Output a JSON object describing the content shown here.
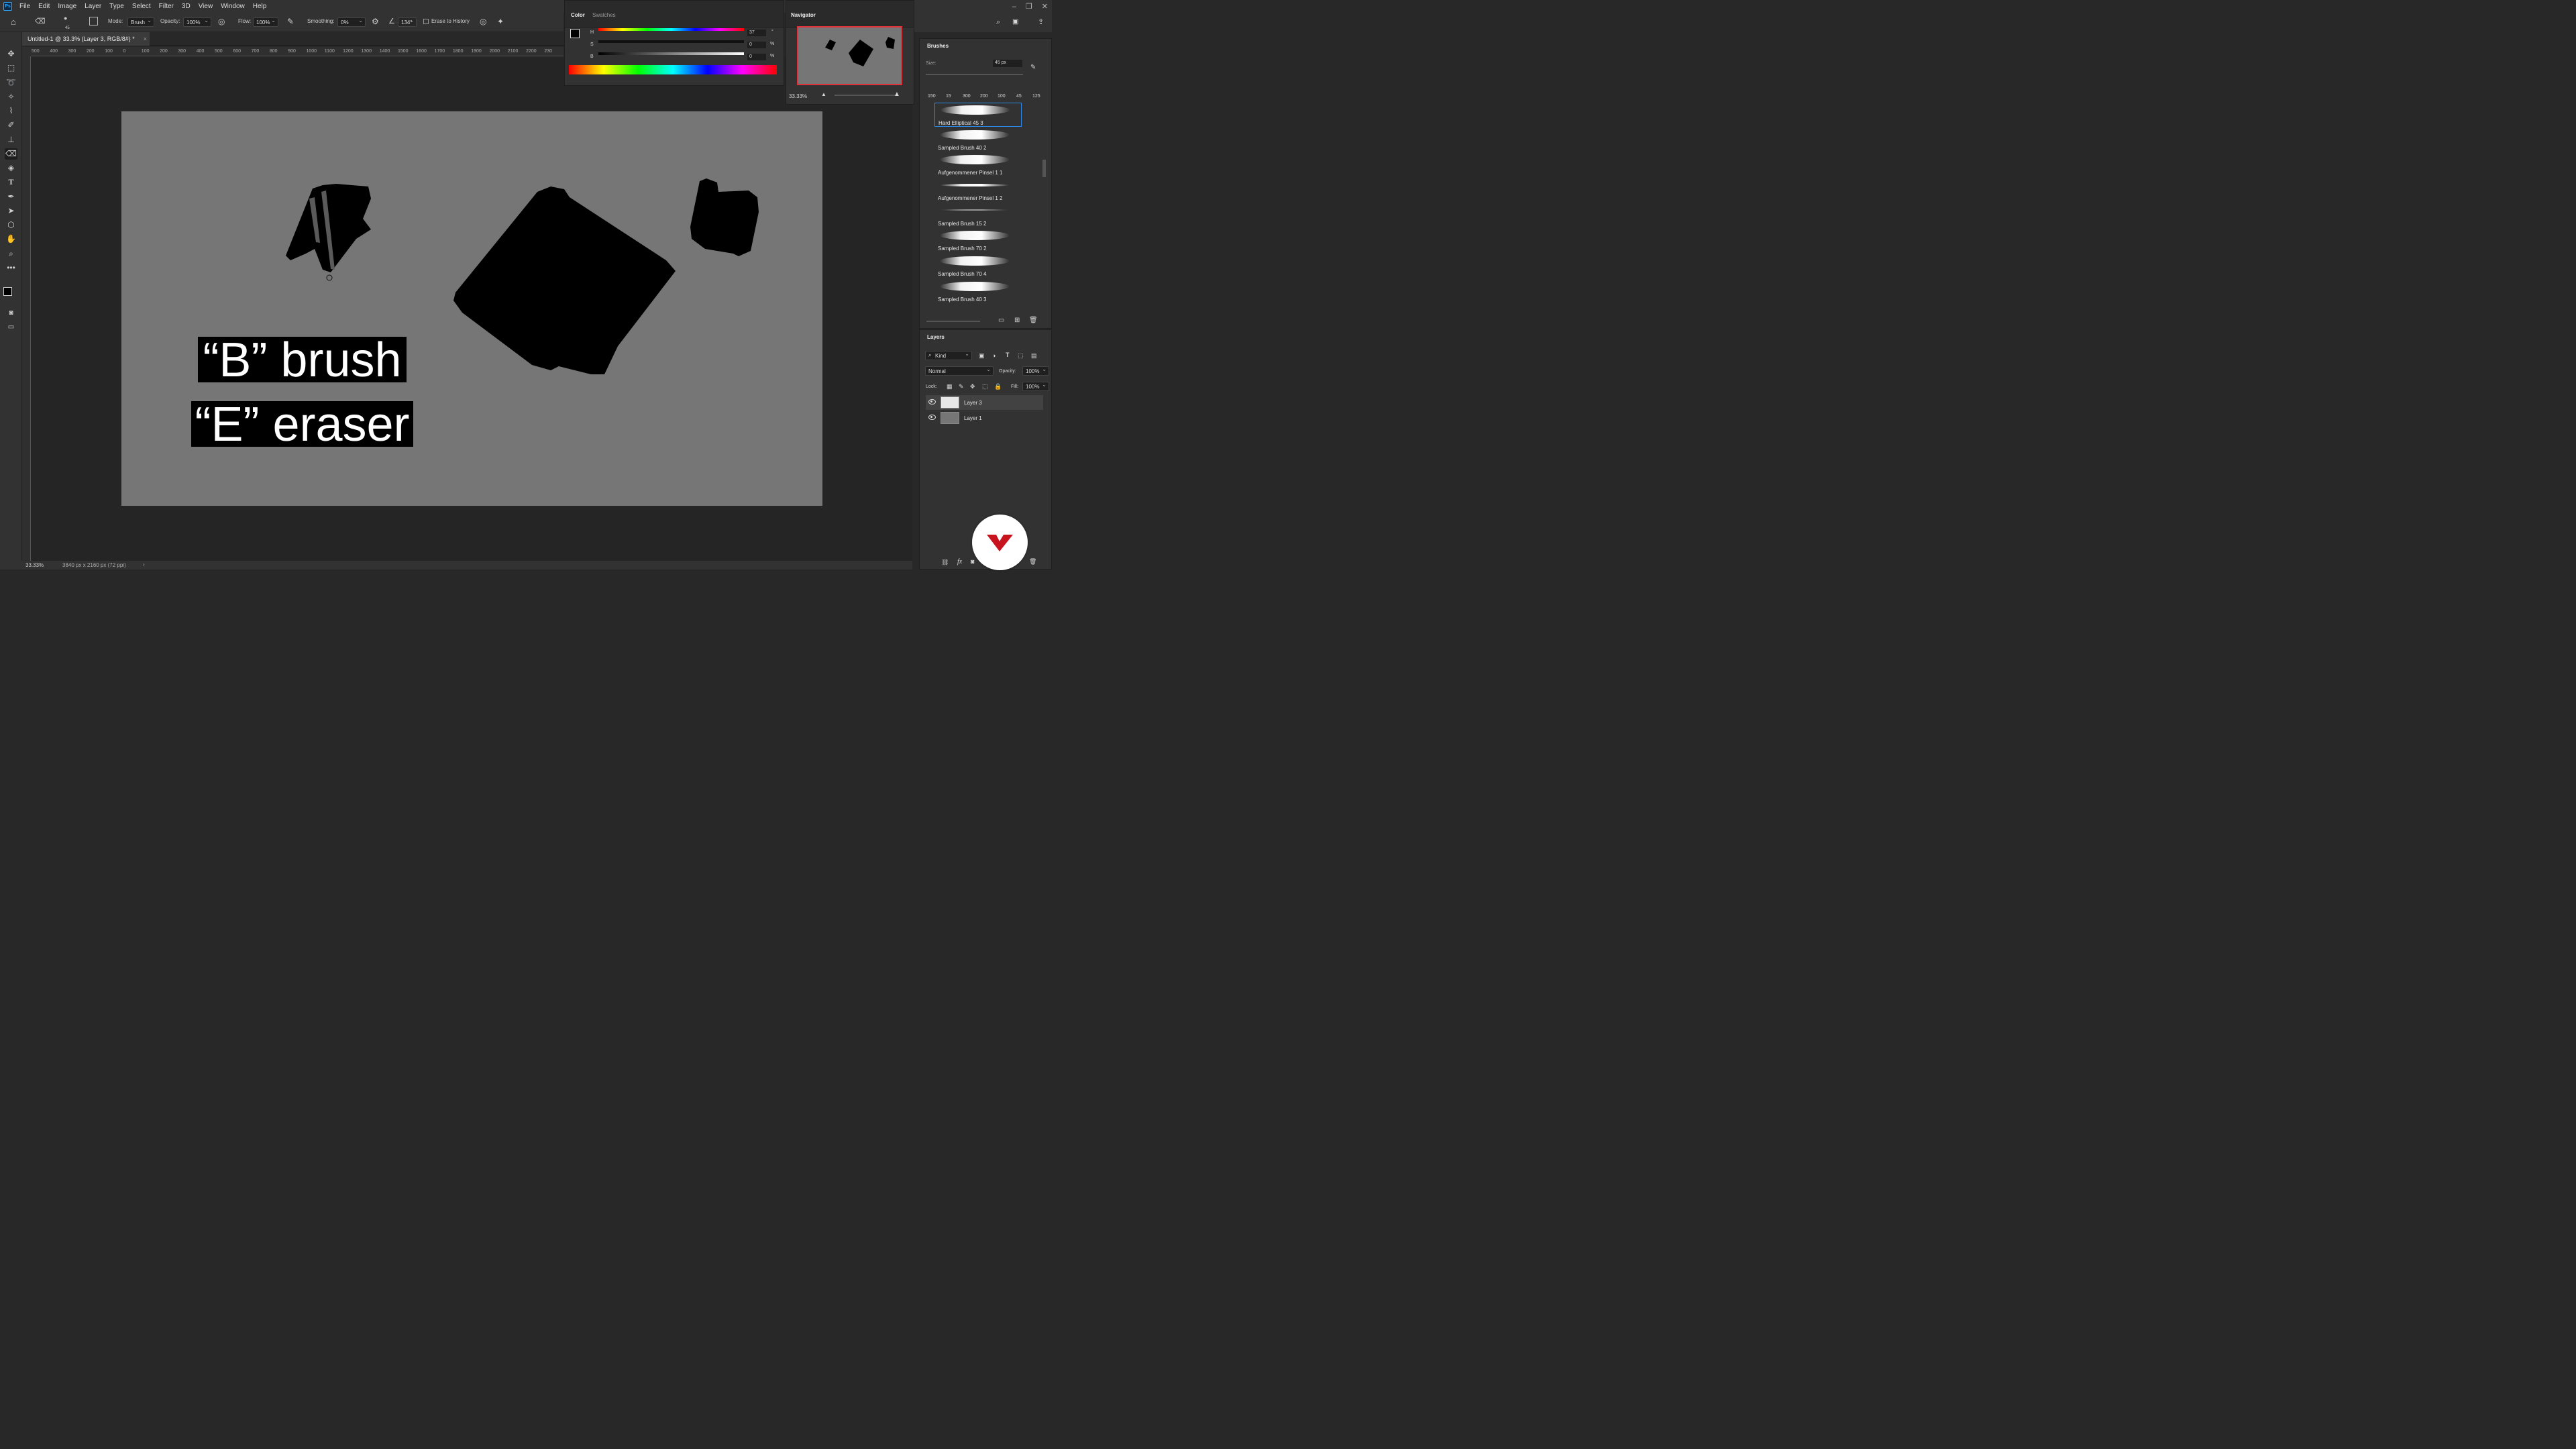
{
  "menu": {
    "items": [
      "File",
      "Edit",
      "Image",
      "Layer",
      "Type",
      "Select",
      "Filter",
      "3D",
      "View",
      "Window",
      "Help"
    ]
  },
  "options": {
    "brush_size": "45",
    "mode_label": "Mode:",
    "mode_value": "Brush",
    "opacity_label": "Opacity:",
    "opacity_value": "100%",
    "flow_label": "Flow:",
    "flow_value": "100%",
    "smoothing_label": "Smoothing:",
    "smoothing_value": "0%",
    "angle_value": "134°",
    "erase_history_label": "Erase to History"
  },
  "document": {
    "tab_title": "Untitled-1 @ 33.3% (Layer 3, RGB/8#) *",
    "ruler_ticks": [
      "500",
      "400",
      "300",
      "200",
      "100",
      "0",
      "100",
      "200",
      "300",
      "400",
      "500",
      "600",
      "700",
      "800",
      "900",
      "1000",
      "1100",
      "1200",
      "1300",
      "1400",
      "1500",
      "1600",
      "1700",
      "1800",
      "1900",
      "2000",
      "2100",
      "2200",
      "230"
    ]
  },
  "canvas_text": {
    "line1": "“B” brush",
    "line2": "“E” eraser"
  },
  "status": {
    "zoom": "33.33%",
    "doc_info": "3840 px x 2160 px (72 ppi)"
  },
  "color_panel": {
    "tabs": [
      "Color",
      "Swatches"
    ],
    "h_label": "H",
    "h_value": "37",
    "h_unit": "°",
    "s_label": "S",
    "s_value": "0",
    "s_unit": "%",
    "b_label": "B",
    "b_value": "0",
    "b_unit": "%"
  },
  "navigator": {
    "title": "Navigator",
    "zoom": "33.33%"
  },
  "brushes": {
    "title": "Brushes",
    "size_label": "Size:",
    "size_value": "45 px",
    "presets": [
      "150",
      "15",
      "300",
      "200",
      "100",
      "45",
      "125"
    ],
    "items": [
      "Hard Elliptical 45 3",
      "Sampled Brush 40 2",
      "Aufgenommener Pinsel 1 1",
      "Aufgenommener Pinsel 1 2",
      "Sampled Brush 15 2",
      "Sampled Brush 70 2",
      "Sampled Brush 70 4",
      "Sampled Brush 40 3"
    ]
  },
  "layers": {
    "title": "Layers",
    "filter_kind": "Kind",
    "blend_mode": "Normal",
    "opacity_label": "Opacity:",
    "opacity_value": "100%",
    "lock_label": "Lock:",
    "fill_label": "Fill:",
    "fill_value": "100%",
    "items": [
      "Layer 3",
      "Layer 1"
    ]
  },
  "colors": {
    "canvas": "#767676",
    "accent": "#2d8ceb",
    "logo_red": "#c8141e"
  }
}
